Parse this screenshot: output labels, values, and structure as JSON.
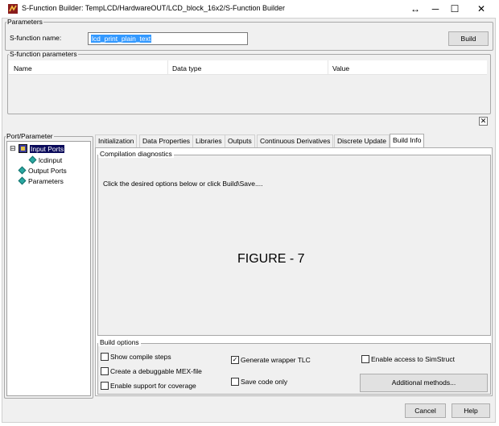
{
  "window": {
    "title": "S-Function Builder: TempLCD/HardwareOUT/LCD_block_16x2/S-Function Builder",
    "controls": {
      "resize": "↔",
      "minimize": "─",
      "maximize": "☐",
      "close": "✕"
    }
  },
  "parameters": {
    "group_label": "Parameters",
    "sfunction_name_label": "S-function name:",
    "sfunction_name_value": "lcd_print_plain_text",
    "build_label": "Build"
  },
  "sfunction_parameters": {
    "group_label": "S-function parameters",
    "columns": [
      "Name",
      "Data type",
      "Value"
    ],
    "close_glyph": "✕"
  },
  "port_parameter": {
    "group_label": "Port/Parameter",
    "tree": {
      "expander": "⊟",
      "items": [
        "Input Ports",
        "lcdinput",
        "Output Ports",
        "Parameters"
      ]
    }
  },
  "tabs": [
    "Initialization",
    "Data Properties",
    "Libraries",
    "Outputs",
    "Continuous Derivatives",
    "Discrete Update",
    "Build Info"
  ],
  "active_tab": "Build Info",
  "compilation": {
    "group_label": "Compilation diagnostics",
    "message": "Click the desired options below or click Build\\Save....",
    "figure_label": "FIGURE - 7"
  },
  "build_options": {
    "group_label": "Build options",
    "checkboxes": [
      {
        "label": "Show compile steps",
        "checked": false
      },
      {
        "label": "Create a debuggable MEX-file",
        "checked": false
      },
      {
        "label": "Enable support for coverage",
        "checked": false
      },
      {
        "label": "Generate wrapper TLC",
        "checked": true
      },
      {
        "label": "Save code only",
        "checked": false
      },
      {
        "label": "Enable access to SimStruct",
        "checked": false
      }
    ],
    "additional_methods_label": "Additional methods...",
    "check_glyph": "✓"
  },
  "footer": {
    "cancel_label": "Cancel",
    "help_label": "Help"
  }
}
